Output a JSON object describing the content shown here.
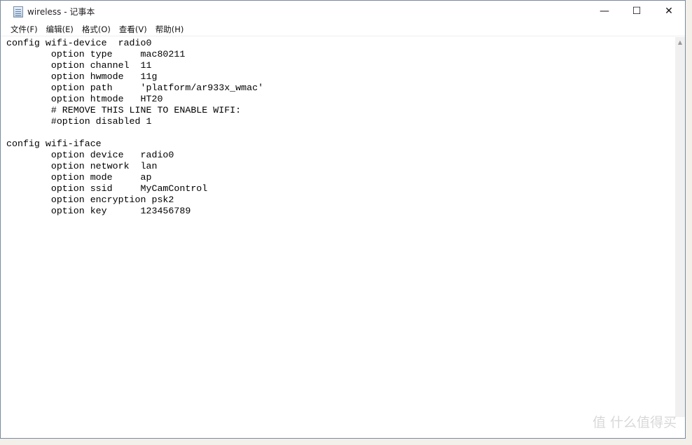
{
  "window": {
    "title": "wireless - 记事本",
    "controls": {
      "minimize": "—",
      "maximize": "☐",
      "close": "✕"
    }
  },
  "menu": [
    "文件(F)",
    "编辑(E)",
    "格式(O)",
    "查看(V)",
    "帮助(H)"
  ],
  "content": "config wifi-device  radio0\n\toption type     mac80211\n\toption channel  11\n\toption hwmode   11g\n\toption path     'platform/ar933x_wmac'\n\toption htmode   HT20\n\t# REMOVE THIS LINE TO ENABLE WIFI:\n\t#option disabled 1\n\nconfig wifi-iface\n\toption device   radio0\n\toption network  lan\n\toption mode     ap\n\toption ssid     MyCamControl\n\toption encryption psk2\n\toption key      123456789",
  "watermark": "值 什么值得买"
}
